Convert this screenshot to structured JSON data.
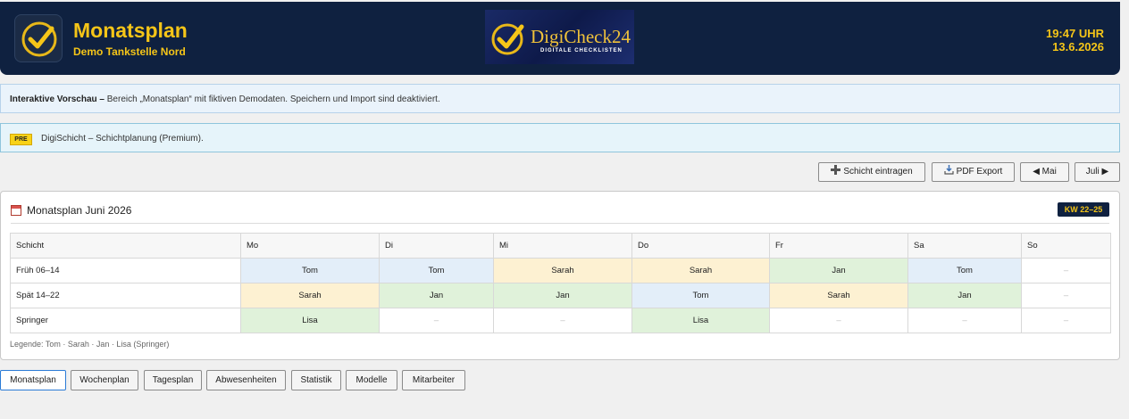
{
  "header": {
    "title": "Monatsplan",
    "subtitle": "Demo Tankstelle Nord",
    "logo_text": "DigiCheck24",
    "logo_subtitle": "DIGITALE CHECKLISTEN",
    "time": "19:47 UHR",
    "date": "13.6.2026",
    "accent_color": "#f5c518",
    "background_color": "#0f2140"
  },
  "info_banner": {
    "bold": "Interaktive Vorschau –",
    "text": "Bereich „Monatsplan“ mit fiktiven Demodaten. Speichern und Import sind deaktiviert."
  },
  "premium_banner": {
    "badge": "PRE",
    "text": "DigiSchicht – Schichtplanung (Premium)."
  },
  "toolbar": {
    "add_shift": "Schicht eintragen",
    "add_shift_icon": "plus-icon",
    "pdf_export": "PDF Export",
    "pdf_icon": "download-icon",
    "prev_month": "◀ Mai",
    "next_month": "Juli ▶"
  },
  "plan": {
    "title": "Monatsplan Juni 2026",
    "icon": "calendar-icon",
    "week_badge": "KW 22–25",
    "columns": [
      "Schicht",
      "Mo",
      "Di",
      "Mi",
      "Do",
      "Fr",
      "Sa",
      "So"
    ],
    "rows": [
      {
        "label": "Früh 06–14",
        "label_bold": false,
        "cells": [
          {
            "text": "Tom",
            "type": "tom"
          },
          {
            "text": "Tom",
            "type": "tom"
          },
          {
            "text": "Sarah",
            "type": "sarah"
          },
          {
            "text": "Sarah",
            "type": "sarah"
          },
          {
            "text": "Jan",
            "type": "jan"
          },
          {
            "text": "Tom",
            "type": "tom"
          },
          {
            "text": "–",
            "type": "empty"
          }
        ]
      },
      {
        "label": "Spät 14–22",
        "label_bold": false,
        "cells": [
          {
            "text": "Sarah",
            "type": "sarah"
          },
          {
            "text": "Jan",
            "type": "jan"
          },
          {
            "text": "Jan",
            "type": "jan"
          },
          {
            "text": "Tom",
            "type": "tom"
          },
          {
            "text": "Sarah",
            "type": "sarah"
          },
          {
            "text": "Jan",
            "type": "jan"
          },
          {
            "text": "–",
            "type": "empty"
          }
        ]
      },
      {
        "label": "Springer",
        "label_bold": true,
        "cells": [
          {
            "text": "Lisa",
            "type": "lisa"
          },
          {
            "text": "–",
            "type": "empty"
          },
          {
            "text": "–",
            "type": "empty"
          },
          {
            "text": "Lisa",
            "type": "lisa"
          },
          {
            "text": "–",
            "type": "empty"
          },
          {
            "text": "–",
            "type": "empty"
          },
          {
            "text": "–",
            "type": "empty"
          }
        ]
      }
    ],
    "legend": "Legende: Tom · Sarah · Jan · Lisa (Springer)"
  },
  "tabs": [
    {
      "label": "Monatsplan",
      "active": true
    },
    {
      "label": "Wochenplan",
      "active": false
    },
    {
      "label": "Tagesplan",
      "active": false
    },
    {
      "label": "Abwesenheiten",
      "active": false
    },
    {
      "label": "Statistik",
      "active": false
    },
    {
      "label": "Modelle",
      "active": false
    },
    {
      "label": "Mitarbeiter",
      "active": false
    }
  ]
}
